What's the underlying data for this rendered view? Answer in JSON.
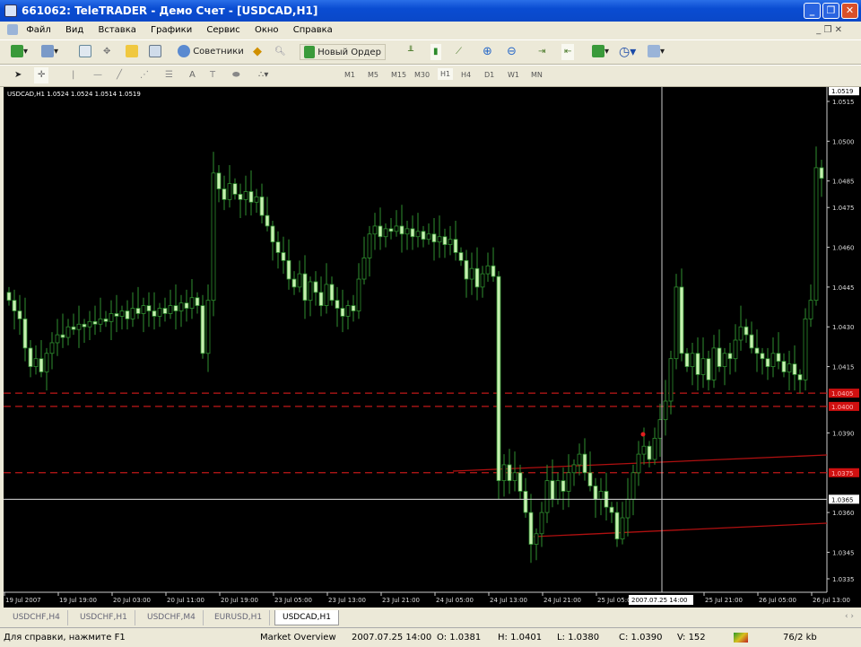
{
  "window": {
    "title": "661062: TeleTRADER - Демо Счет - [USDCAD,H1]",
    "buttons": [
      "_",
      "❐",
      "✕"
    ]
  },
  "menu": [
    "Файл",
    "Вид",
    "Вставка",
    "Графики",
    "Сервис",
    "Окно",
    "Справка"
  ],
  "toolbar": {
    "advisors_label": "Советники",
    "new_order_label": "Новый Ордер",
    "text_tool": "A"
  },
  "timeframes": [
    "M1",
    "M5",
    "M15",
    "M30",
    "H1",
    "H4",
    "D1",
    "W1",
    "MN"
  ],
  "active_timeframe": "H1",
  "chart": {
    "info": "USDCAD,H1  1.0524 1.0524 1.0514 1.0519",
    "price_labels": [
      "1.0515",
      "1.0500",
      "1.0485",
      "1.0475",
      "1.0460",
      "1.0445",
      "1.0430",
      "1.0415",
      "1.0390",
      "1.0360",
      "1.0345",
      "1.0335"
    ],
    "current_price": "1.0519",
    "crosshair_price": "1.0365",
    "level_lines": [
      {
        "price": 1.0405,
        "label": "1.0405"
      },
      {
        "price": 1.04,
        "label": "1.0400"
      },
      {
        "price": 1.0375,
        "label": "1.0375"
      }
    ],
    "time_labels": [
      "19 Jul 2007",
      "19 Jul 19:00",
      "20 Jul 03:00",
      "20 Jul 11:00",
      "20 Jul 19:00",
      "23 Jul 05:00",
      "23 Jul 13:00",
      "23 Jul 21:00",
      "24 Jul 05:00",
      "24 Jul 13:00",
      "24 Jul 21:00",
      "25 Jul 05:00",
      "25 Jul 21:00",
      "26 Jul 05:00",
      "26 Jul 13:00"
    ],
    "crosshair_time": "2007.07.25 14:00",
    "colors": {
      "bull": "#2f8f2f",
      "bear_fill": "#c6f0b0",
      "level": "#c01818",
      "trend": "#b01010"
    },
    "closes": [
      1.044,
      1.0436,
      1.0433,
      1.0422,
      1.0415,
      1.0418,
      1.0413,
      1.042,
      1.0424,
      1.0427,
      1.0426,
      1.043,
      1.0429,
      1.0431,
      1.043,
      1.0432,
      1.0431,
      1.0433,
      1.0432,
      1.0435,
      1.0434,
      1.0436,
      1.0433,
      1.0437,
      1.0435,
      1.0438,
      1.0436,
      1.0434,
      1.0437,
      1.0435,
      1.0438,
      1.0436,
      1.0439,
      1.0437,
      1.0441,
      1.0438,
      1.042,
      1.044,
      1.0488,
      1.0482,
      1.0478,
      1.0484,
      1.048,
      1.0478,
      1.0481,
      1.0477,
      1.0479,
      1.0472,
      1.0468,
      1.0462,
      1.0458,
      1.0455,
      1.0448,
      1.0445,
      1.045,
      1.044,
      1.0447,
      1.0443,
      1.0438,
      1.0446,
      1.044,
      1.0437,
      1.0434,
      1.0438,
      1.0436,
      1.0448,
      1.0456,
      1.0465,
      1.0468,
      1.0464,
      1.0467,
      1.0466,
      1.0468,
      1.0465,
      1.0467,
      1.0464,
      1.0466,
      1.0463,
      1.0465,
      1.0462,
      1.0464,
      1.0461,
      1.0463,
      1.0458,
      1.0455,
      1.0448,
      1.0452,
      1.0445,
      1.045,
      1.0453,
      1.0449,
      1.0372,
      1.0378,
      1.0372,
      1.0375,
      1.0368,
      1.036,
      1.0348,
      1.0352,
      1.036,
      1.0372,
      1.0365,
      1.0372,
      1.0368,
      1.0375,
      1.0378,
      1.0382,
      1.0375,
      1.037,
      1.0365,
      1.0368,
      1.0362,
      1.036,
      1.035,
      1.0358,
      1.0365,
      1.0375,
      1.0382,
      1.0385,
      1.038,
      1.0388,
      1.0395,
      1.0402,
      1.0418,
      1.0445,
      1.042,
      1.0415,
      1.042,
      1.0412,
      1.0418,
      1.041,
      1.0422,
      1.0415,
      1.042,
      1.0418,
      1.0425,
      1.043,
      1.0427,
      1.0422,
      1.042,
      1.0418,
      1.0415,
      1.042,
      1.0417,
      1.0413,
      1.0416,
      1.0412,
      1.041,
      1.0433,
      1.044,
      1.049,
      1.0486
    ]
  },
  "tabs": [
    "USDCHF,H4",
    "USDCHF,H1",
    "USDCHF,M4",
    "EURUSD,H1",
    "USDCAD,H1"
  ],
  "active_tab": "USDCAD,H1",
  "status": {
    "help": "Для справки, нажмите F1",
    "profile": "Market Overview",
    "datetime": "2007.07.25 14:00",
    "open": "O: 1.0381",
    "high": "H: 1.0401",
    "low": "L: 1.0380",
    "close": "C: 1.0390",
    "volume": "V: 152",
    "traffic": "76/2 kb"
  }
}
